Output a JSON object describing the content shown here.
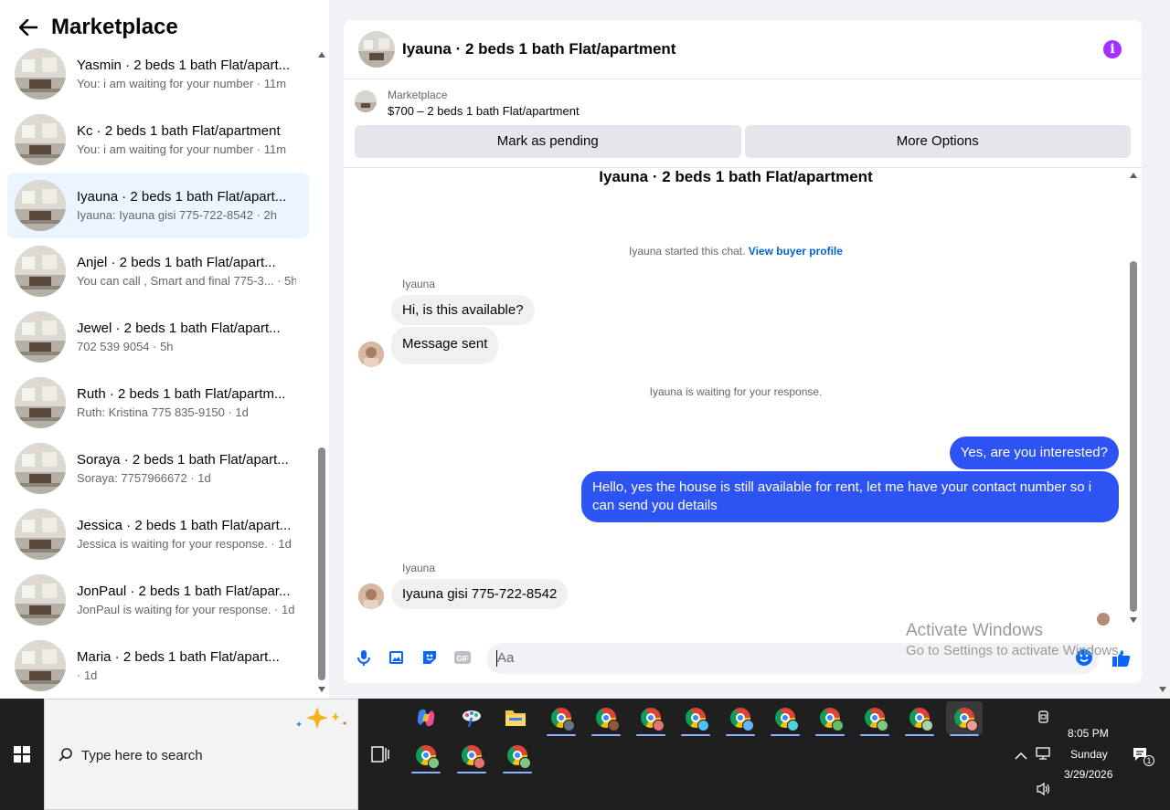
{
  "left": {
    "title": "Marketplace",
    "conversations": [
      {
        "title": "Yasmin · 2 beds 1 bath Flat/apart...",
        "sub": "You: i am waiting for your number · 11m"
      },
      {
        "title": "Kc · 2 beds 1 bath Flat/apartment",
        "sub": "You: i am waiting for your number · 11m"
      },
      {
        "title": "Iyauna · 2 beds 1 bath Flat/apart...",
        "sub": "Iyauna: Iyauna gisi 775-722-8542 · 2h"
      },
      {
        "title": "Anjel · 2 beds 1 bath Flat/apart...",
        "sub": "You can call , Smart and final 775-3...  · 5h"
      },
      {
        "title": "Jewel · 2 beds 1 bath Flat/apart...",
        "sub": "702 539 9054 · 5h"
      },
      {
        "title": "Ruth · 2 beds 1 bath Flat/apartm...",
        "sub": "Ruth: Kristina 775 835-9150 · 1d"
      },
      {
        "title": "Soraya · 2 beds 1 bath Flat/apart...",
        "sub": "Soraya: 7757966672 · 1d"
      },
      {
        "title": "Jessica · 2 beds 1 bath Flat/apart...",
        "sub": "Jessica is waiting for your response. · 1d"
      },
      {
        "title": "JonPaul · 2 beds 1 bath Flat/apar...",
        "sub": "JonPaul is waiting for your response. · 1d"
      },
      {
        "title": "Maria · 2 beds 1 bath Flat/apart...",
        "sub": " · 1d"
      }
    ]
  },
  "chat": {
    "header_title": "Iyauna · 2 beds 1 bath Flat/apartment",
    "listing_category": "Marketplace",
    "listing_price": "$700 – 2 beds 1 bath Flat/apartment",
    "mark_pending": "Mark as pending",
    "more_options": "More Options",
    "thread_title": "Iyauna · 2 beds 1 bath Flat/apartment",
    "started_note": "Iyauna started this chat.",
    "view_profile": "View buyer profile",
    "sender_name": "Iyauna",
    "msg1": "Hi, is this available?",
    "msg2": "Message sent",
    "waiting_note": "Iyauna is waiting for your response.",
    "out1": "Yes, are you interested?",
    "out2": "Hello, yes the house is still available for rent, let me have your contact number so i can send you details",
    "sender_name2": "Iyauna",
    "msg3": "Iyauna gisi 775-722-8542",
    "composer_placeholder": "Aa"
  },
  "watermark": {
    "title": "Activate Windows",
    "sub": "Go to Settings to activate Windows."
  },
  "taskbar": {
    "search_placeholder": "Type here to search",
    "time": "8:05 PM",
    "day": "Sunday",
    "date": "3/29/2026",
    "notification_count": "1"
  },
  "colors": {
    "accent_blue": "#2e53f3",
    "info_purple": "#a033ff",
    "link_blue": "#0064d1",
    "active_row": "#ebf5ff"
  }
}
